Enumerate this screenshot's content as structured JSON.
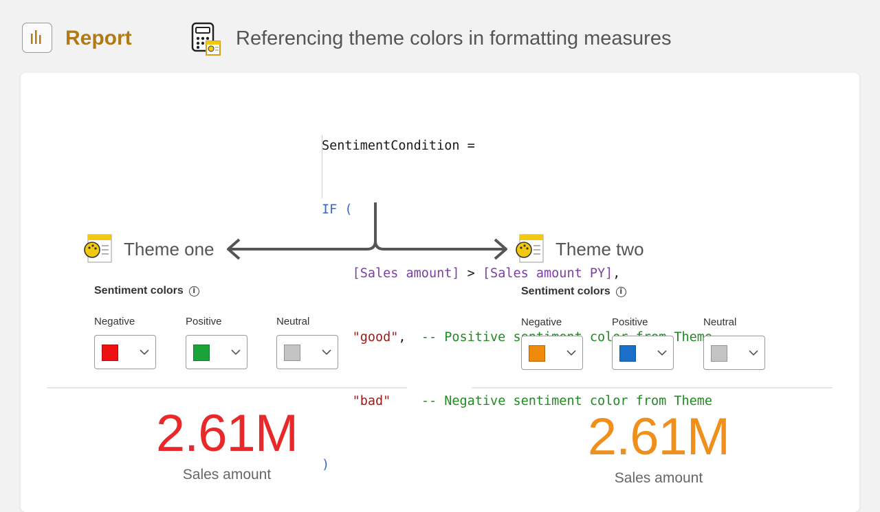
{
  "header": {
    "report_label": "Report",
    "title": "Referencing theme colors in formatting measures",
    "report_icon": "report-bar-chart-icon",
    "title_icon": "calculator-measure-icon"
  },
  "code": {
    "line1": "SentimentCondition =",
    "if_kw": "IF",
    "open_paren": "(",
    "ref1": "[Sales amount]",
    "op": " > ",
    "ref2": "[Sales amount PY]",
    "comma1": ",",
    "str_good": "\"good\"",
    "comma2": ",",
    "cmt_good": "  -- Positive sentiment color from Theme",
    "str_bad": "\"bad\"",
    "cmt_bad": "    -- Negative sentiment color from Theme",
    "close_paren": ")"
  },
  "themes": [
    {
      "name": "Theme one",
      "sentiment_title": "Sentiment colors",
      "swatches": [
        {
          "label": "Negative",
          "color": "#ee1111"
        },
        {
          "label": "Positive",
          "color": "#1aa33a"
        },
        {
          "label": "Neutral",
          "color": "#c3c3c3"
        }
      ],
      "kpi_value": "2.61M",
      "kpi_color": "#e82929",
      "kpi_label": "Sales amount"
    },
    {
      "name": "Theme two",
      "sentiment_title": "Sentiment colors",
      "swatches": [
        {
          "label": "Negative",
          "color": "#f08a0a"
        },
        {
          "label": "Positive",
          "color": "#1a6fc9"
        },
        {
          "label": "Neutral",
          "color": "#c3c3c3"
        }
      ],
      "kpi_value": "2.61M",
      "kpi_color": "#f0901c",
      "kpi_label": "Sales amount"
    }
  ],
  "colors": {
    "accent_report": "#b27a14",
    "code_keyword": "#3b66c4",
    "code_reference": "#7a3fa0",
    "code_string": "#a01a1a",
    "code_comment": "#1f8a1f"
  }
}
